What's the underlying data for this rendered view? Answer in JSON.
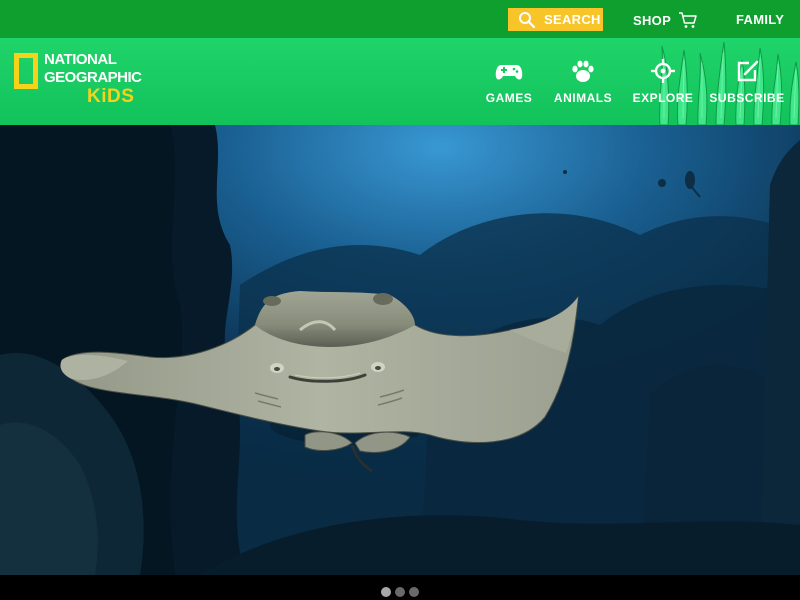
{
  "topbar": {
    "search_label": "SEARCH",
    "shop_label": "SHOP",
    "family_label": "FAMILY"
  },
  "brand": {
    "line1": "NATIONAL",
    "line2": "GEOGRAPHIC",
    "line3": "KiDS"
  },
  "nav": {
    "items": [
      {
        "label": "GAMES",
        "icon": "gamepad-icon"
      },
      {
        "label": "ANIMALS",
        "icon": "paw-icon"
      },
      {
        "label": "EXPLORE",
        "icon": "crosshair-icon"
      },
      {
        "label": "SUBSCRIBE",
        "icon": "edit-icon"
      }
    ]
  },
  "hero": {
    "subject": "stingray underwater",
    "slide_count": 3,
    "active_slide": 1
  },
  "colors": {
    "topbar_green": "#0e9f2e",
    "header_green": "#1fd46a",
    "search_yellow": "#f7c52a",
    "logo_yellow": "#f5d31b"
  }
}
